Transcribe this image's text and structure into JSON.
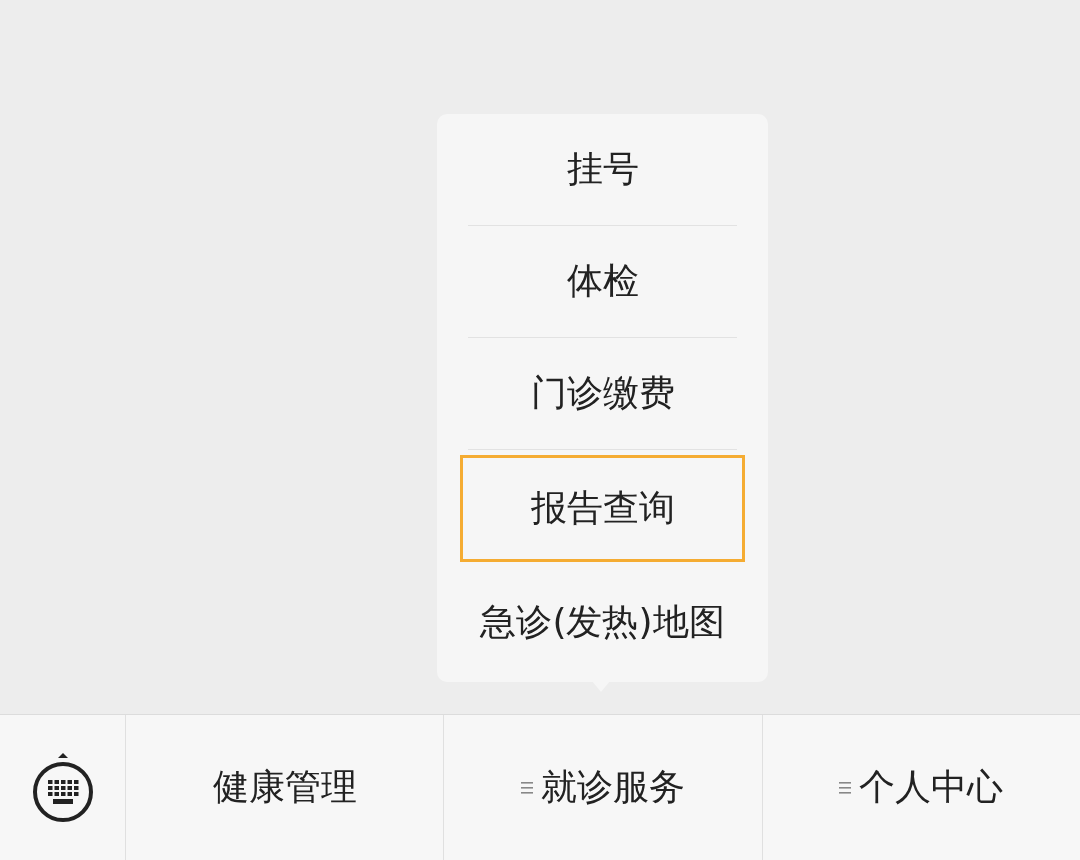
{
  "popup_menu": {
    "items": [
      {
        "label": "挂号",
        "selected": false
      },
      {
        "label": "体检",
        "selected": false
      },
      {
        "label": "门诊缴费",
        "selected": false
      },
      {
        "label": "报告查询",
        "selected": true
      },
      {
        "label": "急诊(发热)地图",
        "selected": false
      }
    ]
  },
  "bottom_menu": {
    "items": [
      {
        "label": "健康管理",
        "has_submenu": false
      },
      {
        "label": "就诊服务",
        "has_submenu": true
      },
      {
        "label": "个人中心",
        "has_submenu": true
      }
    ]
  }
}
